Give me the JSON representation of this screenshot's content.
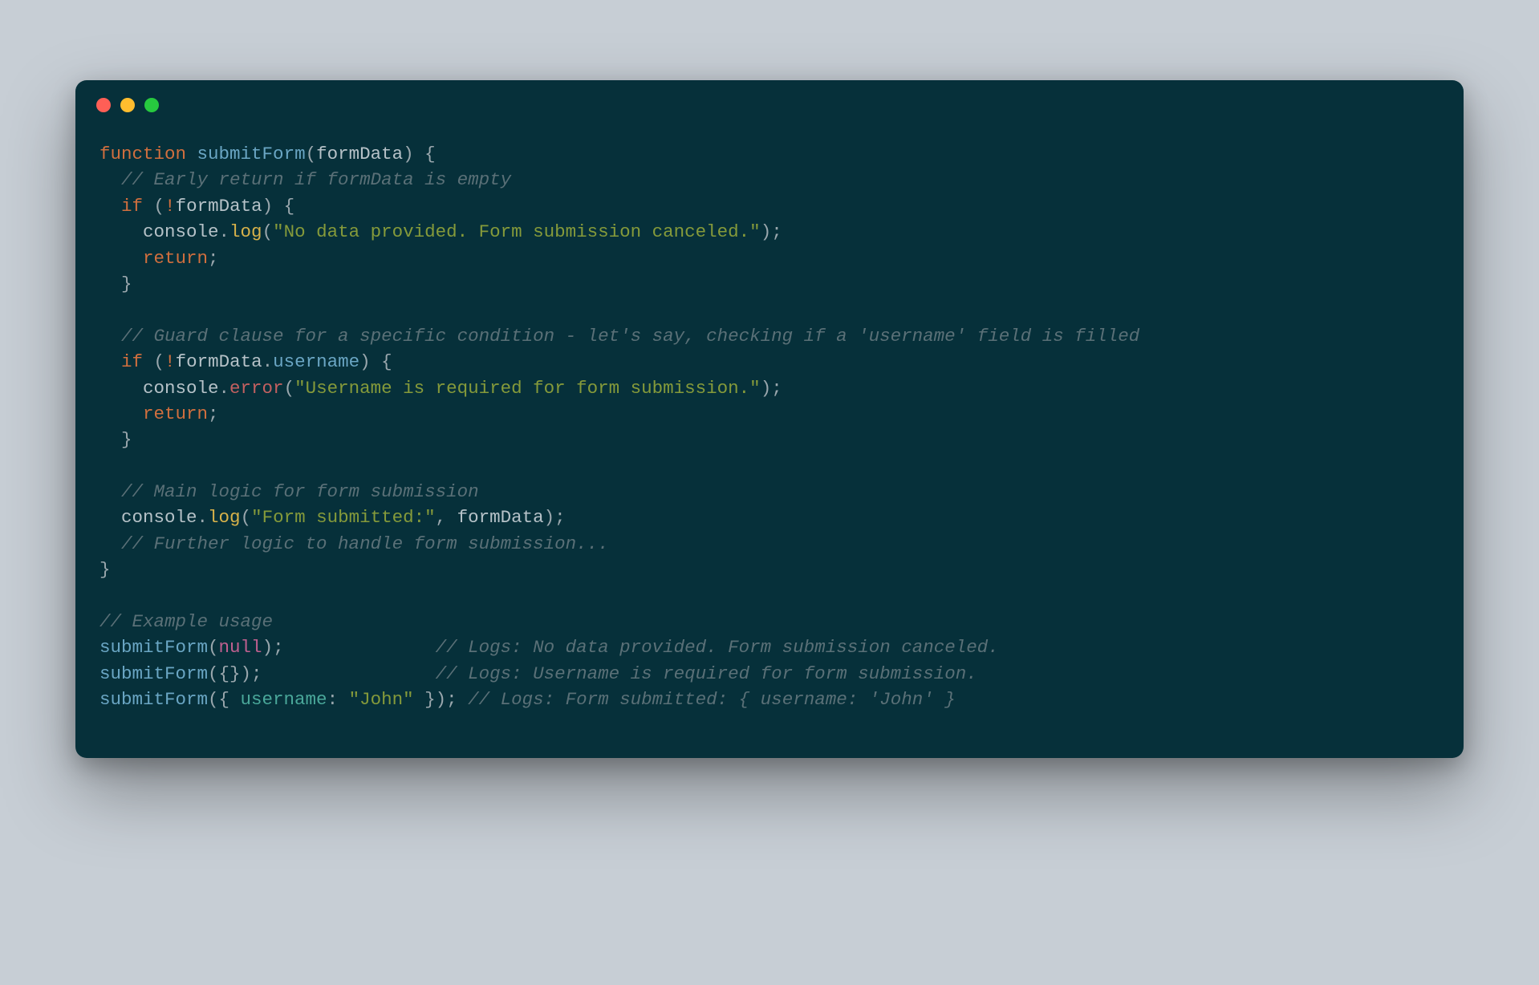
{
  "colors": {
    "background": "#c7ced5",
    "window": "#06303a",
    "dot_red": "#ff5f56",
    "dot_yellow": "#ffbd2e",
    "dot_green": "#27c93f",
    "keyword": "#d16f3e",
    "function": "#6aa6c4",
    "identifier": "#b6c2c8",
    "punctuation": "#9aa7ad",
    "comment": "#5a7077",
    "string": "#859a3a",
    "method_log": "#d8b24a",
    "method_error": "#c36060",
    "property": "#6aa6c4",
    "object_key": "#4aa89a",
    "null_literal": "#c06090"
  },
  "code": {
    "l1": {
      "kw1": "function",
      "fn": "submitForm",
      "p1": "(",
      "arg": "formData",
      "p2": ") {"
    },
    "l2": {
      "cmt": "// Early return if formData is empty"
    },
    "l3": {
      "kw": "if",
      "p1": " (",
      "op": "!",
      "id": "formData",
      "p2": ") {"
    },
    "l4": {
      "obj": "console",
      "dot": ".",
      "meth": "log",
      "p1": "(",
      "str": "\"No data provided. Form submission canceled.\"",
      "p2": ");"
    },
    "l5": {
      "kw": "return",
      "p": ";"
    },
    "l6": {
      "p": "}"
    },
    "l7": {
      "cmt": "// Guard clause for a specific condition - let's say, checking if a 'username' field is filled"
    },
    "l8": {
      "kw": "if",
      "p1": " (",
      "op": "!",
      "id": "formData",
      "dot": ".",
      "prop": "username",
      "p2": ") {"
    },
    "l9": {
      "obj": "console",
      "dot": ".",
      "meth": "error",
      "p1": "(",
      "str": "\"Username is required for form submission.\"",
      "p2": ");"
    },
    "l10": {
      "kw": "return",
      "p": ";"
    },
    "l11": {
      "p": "}"
    },
    "l12": {
      "cmt": "// Main logic for form submission"
    },
    "l13": {
      "obj": "console",
      "dot": ".",
      "meth": "log",
      "p1": "(",
      "str": "\"Form submitted:\"",
      "c": ", ",
      "id": "formData",
      "p2": ");"
    },
    "l14": {
      "cmt": "// Further logic to handle form submission..."
    },
    "l15": {
      "p": "}"
    },
    "l16": {
      "cmt": "// Example usage"
    },
    "l17": {
      "fn": "submitForm",
      "p1": "(",
      "arg": "null",
      "p2": ");",
      "pad": "              ",
      "cmt": "// Logs: No data provided. Form submission canceled."
    },
    "l18": {
      "fn": "submitForm",
      "p1": "({});",
      "pad": "                ",
      "cmt": "// Logs: Username is required for form submission."
    },
    "l19": {
      "fn": "submitForm",
      "p1": "({ ",
      "key": "username",
      "c": ": ",
      "str": "\"John\"",
      "p2": " }); ",
      "cmt": "// Logs: Form submitted: { username: 'John' }"
    }
  }
}
